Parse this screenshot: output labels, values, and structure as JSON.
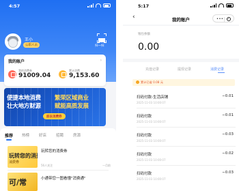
{
  "left": {
    "status": {
      "time": "4:57"
    },
    "user": {
      "name": "王小",
      "tag": "公职人员"
    },
    "scan_label": "扫一扫",
    "account": {
      "title": "我的账户",
      "stats": [
        {
          "label": "我的消费券",
          "value": "91009.04"
        },
        {
          "label": "累计消费",
          "value": "9,153.60"
        }
      ]
    },
    "banner": {
      "line1": "便捷本地消费",
      "line2": "壮大地方财源",
      "line3": "繁荣区域商业",
      "line4": "赋能高质发展",
      "button": "前去消费券"
    },
    "tabs": [
      "推荐",
      "热榜",
      "好店",
      "招聘",
      "房源"
    ],
    "feed": [
      {
        "thumb_title": "玩转您的消费券",
        "thumb_sub": "消费券",
        "title": "玩转您的消费券",
        "meta_left": "56人关注",
        "meta_right": "一月前"
      },
      {
        "thumb_title": "可/常",
        "title": "小通带您一图看懂\"消费通\""
      }
    ]
  },
  "right": {
    "status": {
      "time": "5:17"
    },
    "nav": {
      "back": "‹",
      "title": "我的账户",
      "capsule_dots": "•••"
    },
    "balance": {
      "label": "钱包余额",
      "amount": "0.00"
    },
    "tabs": [
      "充值记录",
      "提现记录",
      "消费记录"
    ],
    "notice": "累计已省 0.08 元",
    "records": [
      {
        "name": "扫码付款-生活店铺",
        "date": "2025-11-03 10:00:07",
        "amount": "−0.01"
      },
      {
        "name": "扫码付款",
        "date": "2025-11-03 10:00:07",
        "amount": "−0.01"
      },
      {
        "name": "扫码付款",
        "date": "2025-11-03 10:00:07",
        "amount": "−0.03"
      },
      {
        "name": "扫码付款",
        "date": "2025-11-03 10:00:07",
        "amount": "−0.02"
      },
      {
        "name": "扫码付款",
        "date": "2025-11-03 10:00:07",
        "amount": "−0.03"
      }
    ]
  },
  "colors": {
    "brand_blue": "#1f6ff2",
    "accent_yellow": "#ffcf3a",
    "tab_active": "#5b8ff9",
    "notice_red": "#e4572e"
  }
}
